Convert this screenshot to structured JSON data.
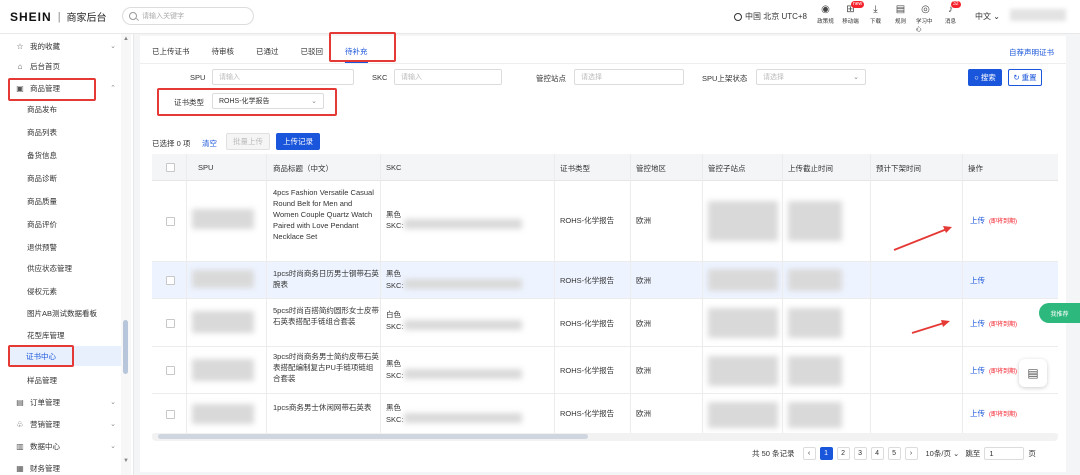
{
  "topbar": {
    "logo": "SHEIN",
    "separator": "|",
    "subtitle": "商家后台",
    "search_placeholder": "请输入关键字",
    "region": "中国 北京 UTC+8",
    "icons": [
      {
        "icon": "shield-icon",
        "label": "政策规"
      },
      {
        "icon": "qr-icon",
        "label": "移动端",
        "badge": "new"
      },
      {
        "icon": "download-icon",
        "label": "下载"
      },
      {
        "icon": "rules-icon",
        "label": "规则"
      },
      {
        "icon": "book-icon",
        "label": "学习中心"
      },
      {
        "icon": "bell-icon",
        "label": "消息",
        "badge": "32"
      }
    ],
    "language": "中文 ⌄"
  },
  "sidebar": {
    "items": [
      {
        "label": "我的收藏",
        "icon": "☆"
      },
      {
        "label": "后台首页",
        "icon": "⌂"
      },
      {
        "label": "商品管理",
        "icon": "▣"
      }
    ],
    "sub_items": [
      "商品发布",
      "商品列表",
      "备货信息",
      "商品诊断",
      "商品质量",
      "商品评价",
      "退供预警",
      "供应状态管理",
      "侵权元素",
      "图片AB测试数据看板",
      "花型库管理",
      "证书中心",
      "样品管理"
    ],
    "active_sub": "证书中心",
    "bottom_items": [
      {
        "label": "订单管理",
        "icon": "▤"
      },
      {
        "label": "营销管理",
        "icon": "♧"
      },
      {
        "label": "数据中心",
        "icon": "▥"
      },
      {
        "label": "财务管理",
        "icon": "▦"
      }
    ]
  },
  "tabs": [
    "已上传证书",
    "待审核",
    "已通过",
    "已驳回",
    "待补充"
  ],
  "active_tab": "待补充",
  "link_right": "自荐声明证书",
  "filters": {
    "spu_label": "SPU",
    "spu_placeholder": "请输入",
    "skc_label": "SKC",
    "skc_placeholder": "请输入",
    "site_label": "管控站点",
    "site_placeholder": "请选择",
    "status_label": "SPU上架状态",
    "status_placeholder": "请选择",
    "cert_label": "证书类型",
    "cert_value": "ROHS-化学报告",
    "search_btn": "搜索",
    "reset_btn": "重置"
  },
  "toolbar": {
    "selected": "已选择 0 项",
    "clear": "清空",
    "batch_upload": "批量上传",
    "records": "上传记录"
  },
  "columns": [
    "SPU",
    "商品标题（中文）",
    "SKC",
    "证书类型",
    "管控地区",
    "管控子站点",
    "上传截止时间",
    "预计下架时间",
    "操作"
  ],
  "rows": [
    {
      "title": "4pcs Fashion Versatile Casual Round Belt for Men and Women Couple Quartz Watch Paired with Love Pendant Necklace Set",
      "skc_color": "黑色",
      "skc_label": "SKC:",
      "cert": "ROHS-化学报告",
      "region": "欧洲",
      "action": "上传",
      "deadline": "(即将到期)"
    },
    {
      "title": "1pcs时尚商务日历男士钢带石英腕表",
      "skc_color": "黑色",
      "skc_label": "SKC:",
      "cert": "ROHS-化学报告",
      "region": "欧洲",
      "action": "上传",
      "deadline": ""
    },
    {
      "title": "5pcs时尚百搭简约圆形女士皮带石英表搭配手链组合套装",
      "skc_color": "白色",
      "skc_label": "SKC:",
      "cert": "ROHS-化学报告",
      "region": "欧洲",
      "action": "上传",
      "deadline": "(即将到期)"
    },
    {
      "title": "3pcs时尚商务男士简约皮带石英表搭配编制复古PU手链项链组合套装",
      "skc_color": "黑色",
      "skc_label": "SKC:",
      "cert": "ROHS-化学报告",
      "region": "欧洲",
      "action": "上传",
      "deadline": "(即将到期)"
    },
    {
      "title": "1pcs商务男士休闲网带石英表",
      "skc_color": "黑色",
      "skc_label": "SKC:",
      "cert": "ROHS-化学报告",
      "region": "欧洲",
      "action": "上传",
      "deadline": "(即将到期)"
    }
  ],
  "pagination": {
    "total": "共 50 条记录",
    "pages": [
      "1",
      "2",
      "3",
      "4",
      "5"
    ],
    "current": "1",
    "page_size": "10条/页 ⌄",
    "jump_label": "跳至",
    "jump_value": "1",
    "page_suffix": "页"
  },
  "floating": {
    "green_label": "我推荐"
  },
  "colors": {
    "primary": "#1a56db",
    "annotation": "#e53935",
    "highlight_row": "#eef4ff"
  }
}
